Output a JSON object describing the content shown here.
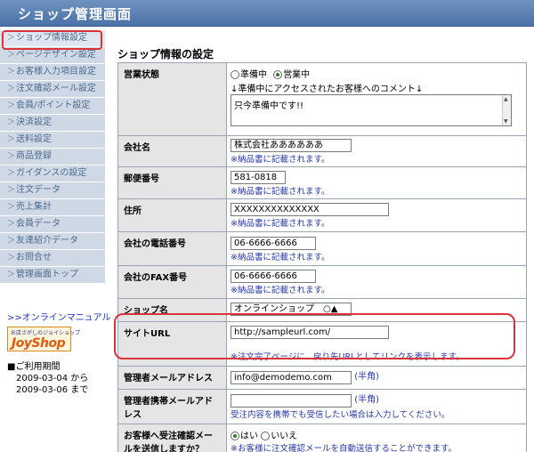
{
  "header": {
    "title": "ショップ管理画面"
  },
  "sidebar": {
    "items": [
      {
        "label": "ショップ情報設定"
      },
      {
        "label": "ページデザイン設定"
      },
      {
        "label": "お客様入力項目設定"
      },
      {
        "label": "注文確認メール設定"
      },
      {
        "label": "会員/ポイント設定"
      },
      {
        "label": "決済設定"
      },
      {
        "label": "送料設定"
      },
      {
        "label": "商品登録"
      },
      {
        "label": "ガイダンスの設定"
      },
      {
        "label": "注文データ"
      },
      {
        "label": "売上集計"
      },
      {
        "label": "会員データ"
      },
      {
        "label": "友達紹介データ"
      },
      {
        "label": "お問合せ"
      },
      {
        "label": "管理画面トップ"
      }
    ],
    "manual_link": ">>オンラインマニュアル",
    "logo": {
      "small": "お店さがしのジョイショップ",
      "big": "JoyShop"
    },
    "period": {
      "title": "■ご利用期間",
      "start": "2009-03-04 から",
      "end": "2009-03-06 まで"
    }
  },
  "main": {
    "title": "ショップ情報の設定",
    "status": {
      "label": "営業状態",
      "option_preparing": "準備中",
      "option_open": "営業中",
      "comment_caption": "↓準備中にアクセスされたお客様へのコメント↓",
      "comment_value": "只今準備中です!!"
    },
    "company": {
      "label": "会社名",
      "value": "株式会社ああああああ",
      "note": "※納品書に記載されます。"
    },
    "postal": {
      "label": "郵便番号",
      "value": "581-0818",
      "note": "※納品書に記載されます。"
    },
    "address": {
      "label": "住所",
      "value": "XXXXXXXXXXXXXX",
      "note": "※納品書に記載されます。"
    },
    "phone": {
      "label": "会社の電話番号",
      "value": "06-6666-6666",
      "note": "※納品書に記載されます。"
    },
    "fax": {
      "label": "会社のFAX番号",
      "value": "06-6666-6666",
      "note": "※納品書に記載されます。"
    },
    "shop_name": {
      "label": "ショップ名",
      "value": "オンラインショップ　○▲"
    },
    "site_url": {
      "label": "サイトURL",
      "value": "http://sampleurl.com/",
      "note": "※注文完了ページに、戻り先URLとしてリンクを表示します。"
    },
    "admin_mail": {
      "label": "管理者メールアドレス",
      "value": "info@demodemo.com",
      "unit": "(半角)"
    },
    "admin_mobile": {
      "label": "管理者携帯メールアドレス",
      "value": "",
      "unit": "(半角)",
      "note": "受注内容を携帯でも受信したい場合は入力してください。"
    },
    "auto_mail": {
      "label": "お客様へ受注確認メールを送信しますか？",
      "option_yes": "はい",
      "option_no": "いいえ",
      "note": "※お客様に注文確認メールを自動送信することができます。"
    }
  }
}
